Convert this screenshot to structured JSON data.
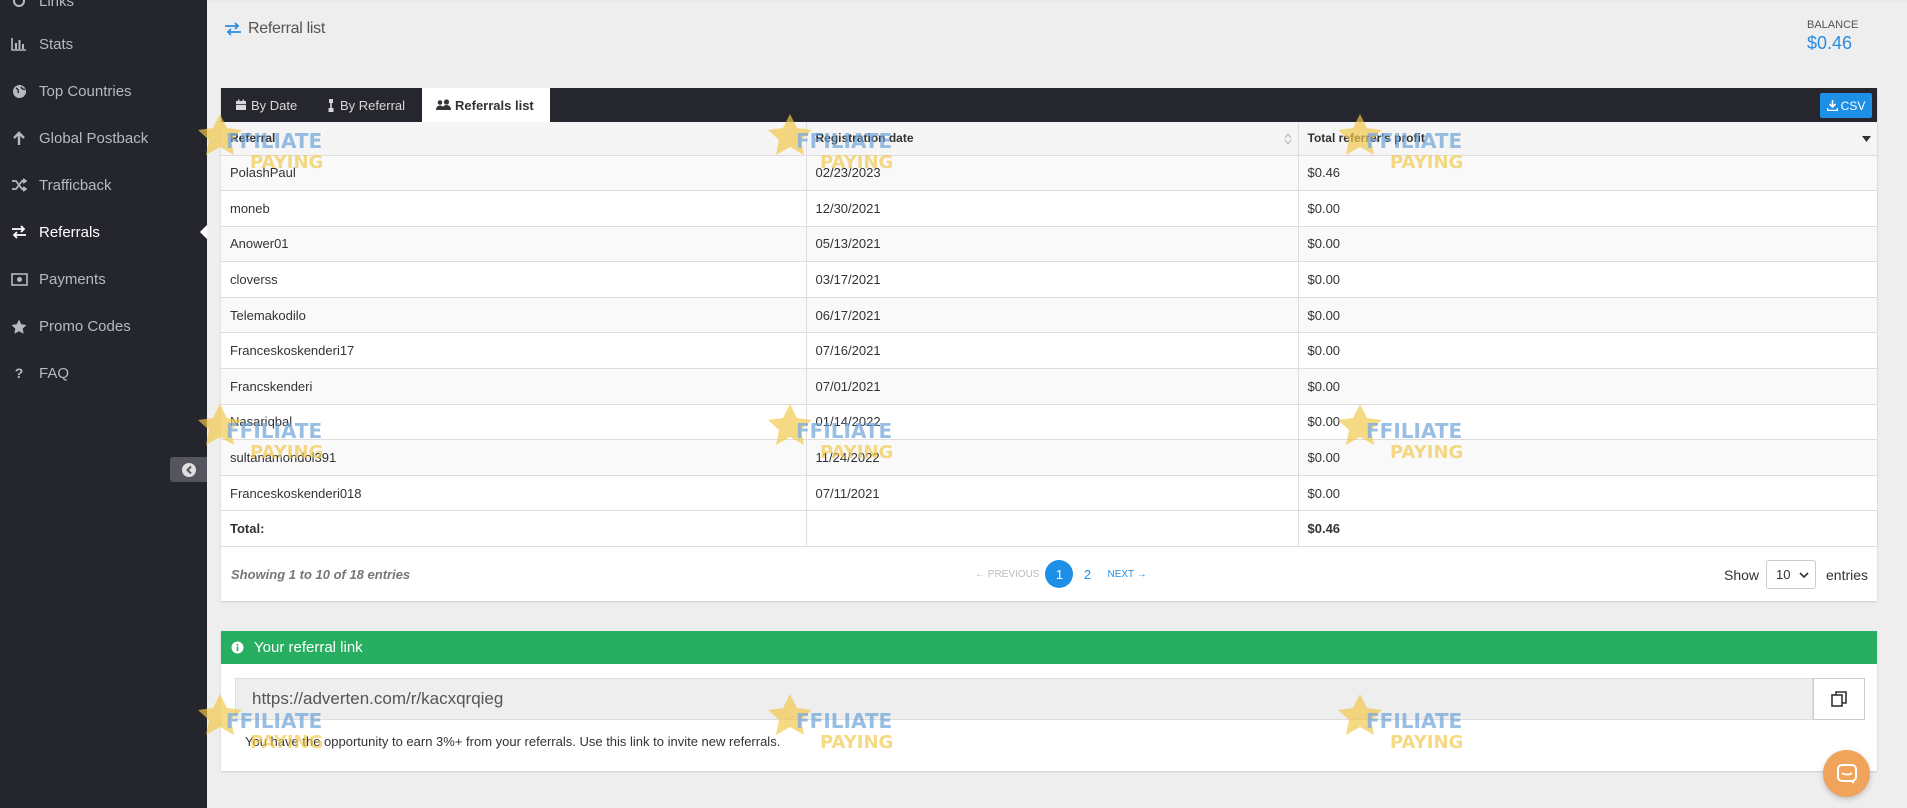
{
  "sidebar": {
    "items": [
      {
        "label": "Links",
        "icon": "link-icon"
      },
      {
        "label": "Stats",
        "icon": "bar-chart-icon"
      },
      {
        "label": "Top Countries",
        "icon": "globe-icon"
      },
      {
        "label": "Global Postback",
        "icon": "arrow-up-icon"
      },
      {
        "label": "Trafficback",
        "icon": "shuffle-icon"
      },
      {
        "label": "Referrals",
        "icon": "exchange-icon",
        "active": true
      },
      {
        "label": "Payments",
        "icon": "money-icon"
      },
      {
        "label": "Promo Codes",
        "icon": "star-icon"
      },
      {
        "label": "FAQ",
        "icon": "question-icon"
      }
    ]
  },
  "header": {
    "title": "Referral list",
    "balance_label": "BALANCE",
    "balance_value": "$0.46"
  },
  "tabs": [
    {
      "label": "By Date",
      "icon": "calendar-icon"
    },
    {
      "label": "By Referral",
      "icon": "sitemap-icon"
    },
    {
      "label": "Referrals list",
      "icon": "users-icon",
      "active": true
    }
  ],
  "csv_label": "CSV",
  "table": {
    "columns": [
      "Referral",
      "Registration date",
      "Total referrer's profit"
    ],
    "rows": [
      [
        "PolashPaul",
        "02/23/2023",
        "$0.46"
      ],
      [
        "moneb",
        "12/30/2021",
        "$0.00"
      ],
      [
        "Anower01",
        "05/13/2021",
        "$0.00"
      ],
      [
        "cloverss",
        "03/17/2021",
        "$0.00"
      ],
      [
        "Telemakodilo",
        "06/17/2021",
        "$0.00"
      ],
      [
        "Franceskoskenderi17",
        "07/16/2021",
        "$0.00"
      ],
      [
        "Francskenderi",
        "07/01/2021",
        "$0.00"
      ],
      [
        "Nasariqbal",
        "01/14/2022",
        "$0.00"
      ],
      [
        "sultanamondol391",
        "11/24/2022",
        "$0.00"
      ],
      [
        "Franceskoskenderi018",
        "07/11/2021",
        "$0.00"
      ]
    ],
    "total_label": "Total:",
    "total_value": "$0.46"
  },
  "footer": {
    "info": "Showing 1 to 10 of 18 entries",
    "prev": "← PREVIOUS",
    "pages": [
      "1",
      "2"
    ],
    "current_page": "1",
    "next": "NEXT →",
    "show_label": "Show",
    "page_size": "10",
    "entries_label": "entries"
  },
  "referral_link": {
    "heading": "Your referral link",
    "url": "https://adverten.com/r/kacxqrqieg",
    "note": "You have the opportunity to earn 3%+ from your referrals. Use this link to invite new referrals."
  },
  "watermark": {
    "line1": "AFFILIATE",
    "line2": "PAYING"
  },
  "colors": {
    "sidebar": "#25252e",
    "accent": "#1e8fe6",
    "success": "#27ae60",
    "chat": "#f0a35a"
  }
}
